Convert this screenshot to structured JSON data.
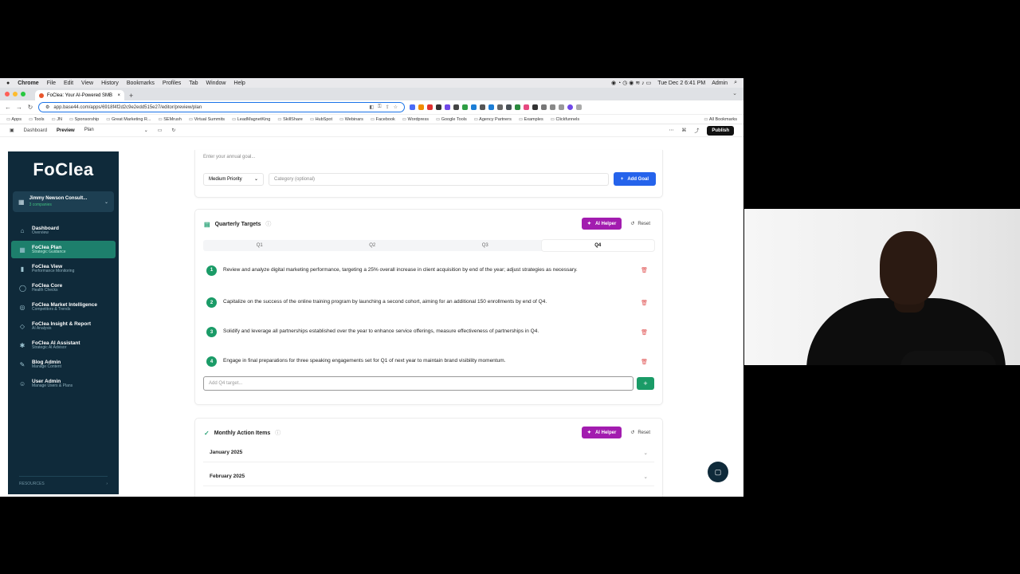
{
  "menubar": {
    "apple": "",
    "app": "Chrome",
    "items": [
      "File",
      "Edit",
      "View",
      "History",
      "Bookmarks",
      "Profiles",
      "Tab",
      "Window",
      "Help"
    ],
    "datetime": "Tue Dec 2  6:41 PM",
    "user": "Admin"
  },
  "browser": {
    "tab_title": "FoClea: Your AI-Powered SMB",
    "new_tab": "+",
    "url": "app.base44.com/apps/6918f4f2d2c9e2edd515e27/editor/preview/plan",
    "bookmarks": [
      "Apps",
      "Tools",
      "JN",
      "Sponsorship",
      "Great Marketing R...",
      "SEMrush",
      "Virtual Summits",
      "LeadMagnetKing",
      "SkillShare",
      "HubSpot",
      "Webinars",
      "Facebook",
      "Wordpress",
      "Google Tools",
      "Agency Partners",
      "Examples",
      "Clickfunnels"
    ],
    "all_bookmarks": "All Bookmarks"
  },
  "editor_toolbar": {
    "dashboard": "Dashboard",
    "preview": "Preview",
    "page": "Plan",
    "publish": "Publish"
  },
  "sidebar": {
    "logo": "FoClea",
    "workspace_name": "Jimmy Newson Consult...",
    "workspace_sub": "3 companies",
    "items": [
      {
        "title": "Dashboard",
        "sub": "Overview",
        "icon": "⌂"
      },
      {
        "title": "FoClea Plan",
        "sub": "Strategic Guidance",
        "icon": "▦"
      },
      {
        "title": "FoClea View",
        "sub": "Performance Monitoring",
        "icon": "▮"
      },
      {
        "title": "FoClea Core",
        "sub": "Health Checks",
        "icon": "◯"
      },
      {
        "title": "FoClea Market Intelligence",
        "sub": "Competitors & Trends",
        "icon": "◎"
      },
      {
        "title": "FoClea Insight & Report",
        "sub": "AI Analysis",
        "icon": "◇"
      },
      {
        "title": "FoClea AI Assistant",
        "sub": "Strategic AI Advisor",
        "icon": "✱"
      },
      {
        "title": "Blog Admin",
        "sub": "Manage Content",
        "icon": "✎"
      },
      {
        "title": "User Admin",
        "sub": "Manage Users & Plans",
        "icon": "☺"
      }
    ],
    "resources": "RESOURCES"
  },
  "goal_form": {
    "goal_placeholder": "Enter your annual goal...",
    "priority": "Medium Priority",
    "category_placeholder": "Category (optional)",
    "add_goal": "Add Goal"
  },
  "quarterly": {
    "title": "Quarterly Targets",
    "ai_helper": "AI Helper",
    "reset": "Reset",
    "tabs": [
      "Q1",
      "Q2",
      "Q3",
      "Q4"
    ],
    "selected_tab": "Q4",
    "targets": [
      {
        "num": "1",
        "text": "Review and analyze digital marketing performance, targeting a 25% overall increase in client acquisition by end of the year; adjust strategies as necessary."
      },
      {
        "num": "2",
        "text": "Capitalize on the success of the online training program by launching a second cohort, aiming for an additional 150 enrollments by end of Q4."
      },
      {
        "num": "3",
        "text": "Solidify and leverage all partnerships established over the year to enhance service offerings, measure effectiveness of partnerships in Q4."
      },
      {
        "num": "4",
        "text": "Engage in final preparations for three speaking engagements set for Q1 of next year to maintain brand visibility momentum."
      }
    ],
    "add_placeholder": "Add Q4 target...",
    "add_btn": "+"
  },
  "monthly": {
    "title": "Monthly Action Items",
    "ai_helper": "AI Helper",
    "reset": "Reset",
    "months": [
      "January 2025",
      "February 2025"
    ]
  },
  "colors": {
    "sidebar_bg": "#0f2a3a",
    "active_nav": "#1d7f6c",
    "add_goal_blue": "#2563eb",
    "ai_helper_purple": "#a21caf",
    "target_green": "#1a9b67"
  }
}
